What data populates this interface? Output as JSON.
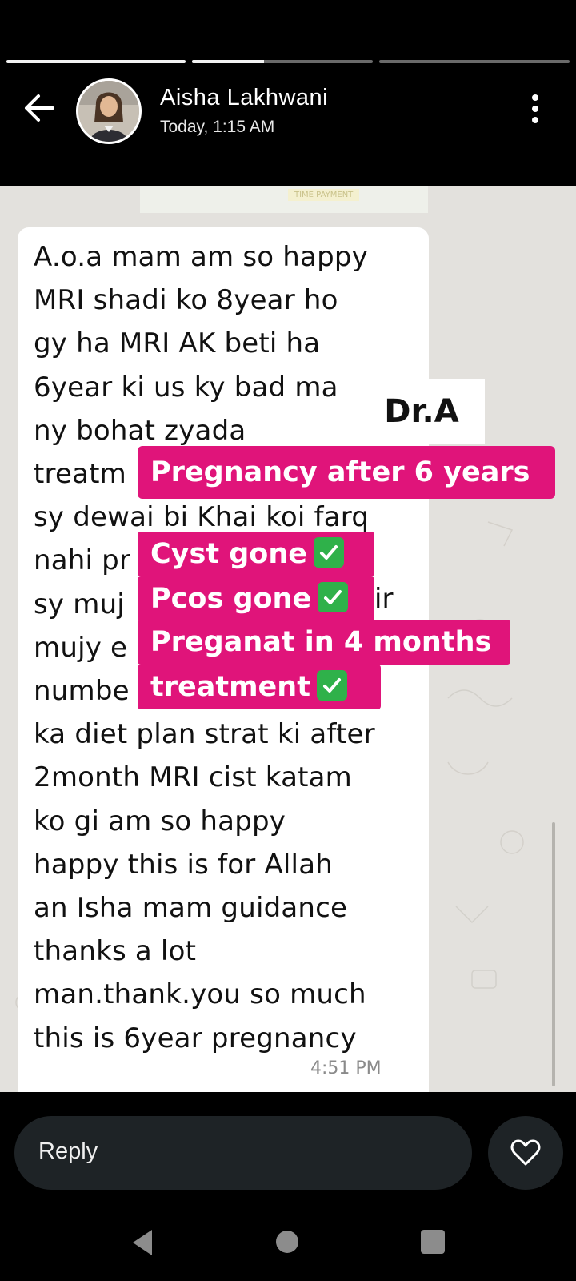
{
  "story": {
    "progress": [
      1.0,
      0.4,
      0.0
    ],
    "user_name": "Aisha Lakhwani",
    "timestamp": "Today, 1:15 AM"
  },
  "message": {
    "text": "A.o.a mam am so happy\nMRI shadi ko 8year ho\ngy ha MRI AK beti ha\n6year ki us ky bad ma\nny bohat zyada\ntreatm\nsy dewai bi Khai koi farq\nnahi pr\nsy muj\nmujy e\nnumbe\nka diet plan strat ki after\n2month MRI cist katam\nko gi am so happy\nhappy this is for Allah\nan Isha mam guidance\nthanks a lot\nman.thank.you so much\nthis is 6year pregnancy",
    "partial_right": "ir",
    "time": "4:51 PM"
  },
  "overlays": {
    "brand": "Dr.A",
    "headline": "Pregnancy after 6 years",
    "points": [
      {
        "text": "Cyst gone",
        "check": true
      },
      {
        "text": "Pcos gone",
        "check": true
      },
      {
        "text": "Preganat in 4 months",
        "check": false
      },
      {
        "text": "treatment",
        "check": true
      }
    ]
  },
  "reply": {
    "placeholder": "Reply"
  },
  "colors": {
    "accent": "#e0147a",
    "check": "#2fb14a"
  },
  "icons": [
    "back-arrow-icon",
    "more-vert-icon",
    "heart-icon",
    "check-icon",
    "nav-back-icon",
    "nav-home-icon",
    "nav-recent-icon"
  ]
}
